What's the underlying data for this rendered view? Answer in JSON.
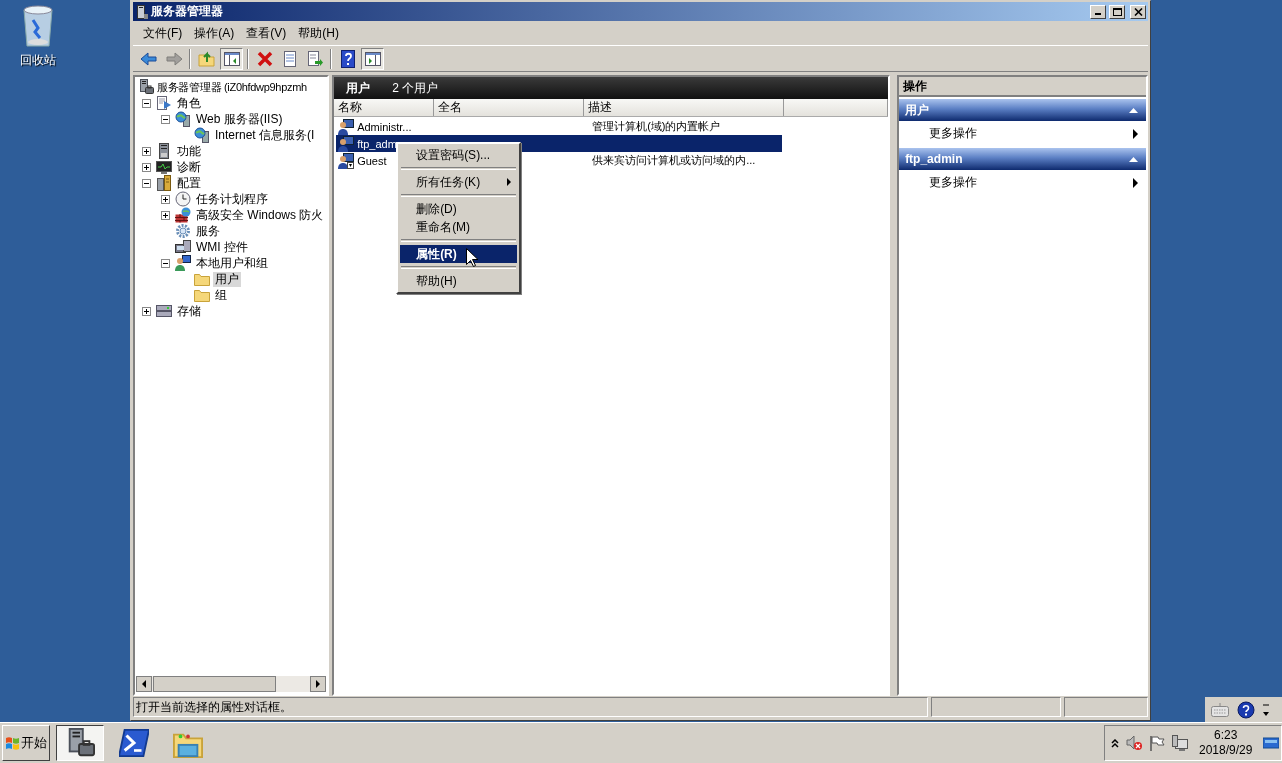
{
  "desktop_icons": [
    {
      "label": "回收站"
    }
  ],
  "window": {
    "title": "服务器管理器"
  },
  "menu": [
    {
      "label": "文件(F)"
    },
    {
      "label": "操作(A)"
    },
    {
      "label": "查看(V)"
    },
    {
      "label": "帮助(H)"
    }
  ],
  "toolbar": [
    {
      "kind": "back",
      "disabled": false,
      "pressed": false
    },
    {
      "kind": "forward",
      "disabled": true,
      "pressed": false
    },
    {
      "kind": "separator"
    },
    {
      "kind": "up",
      "disabled": false,
      "pressed": false
    },
    {
      "kind": "tree",
      "disabled": false,
      "pressed": true
    },
    {
      "kind": "separator"
    },
    {
      "kind": "delete",
      "disabled": false,
      "pressed": false
    },
    {
      "kind": "properties",
      "disabled": false,
      "pressed": false
    },
    {
      "kind": "export",
      "disabled": false,
      "pressed": false
    },
    {
      "kind": "separator"
    },
    {
      "kind": "help",
      "disabled": false,
      "pressed": false
    },
    {
      "kind": "actionpane",
      "disabled": false,
      "pressed": true
    }
  ],
  "tree": [
    {
      "label": "服务器管理器 (iZ0hfdwp9hpzmh",
      "kind": "server",
      "selected": false,
      "children": [
        {
          "label": "角色",
          "kind": "roles",
          "selected": false,
          "expanded": true,
          "children": [
            {
              "label": "Web 服务器(IIS)",
              "kind": "web",
              "selected": false,
              "expanded": true,
              "children": [
                {
                  "label": "Internet 信息服务(I",
                  "kind": "web",
                  "selected": false
                }
              ]
            }
          ]
        },
        {
          "label": "功能",
          "kind": "features",
          "selected": false,
          "expanded": false
        },
        {
          "label": "诊断",
          "kind": "diagnostics",
          "selected": false,
          "expanded": false
        },
        {
          "label": "配置",
          "kind": "config",
          "selected": false,
          "expanded": true,
          "children": [
            {
              "label": "任务计划程序",
              "kind": "scheduler",
              "selected": false,
              "expanded": false
            },
            {
              "label": "高级安全 Windows 防火",
              "kind": "firewall",
              "selected": false,
              "expanded": false
            },
            {
              "label": "服务",
              "kind": "services",
              "selected": false
            },
            {
              "label": "WMI 控件",
              "kind": "wmi",
              "selected": false
            },
            {
              "label": "本地用户和组",
              "kind": "users",
              "selected": false,
              "expanded": true,
              "children": [
                {
                  "label": "用户",
                  "kind": "folder",
                  "selected": true
                },
                {
                  "label": "组",
                  "kind": "folder",
                  "selected": false
                }
              ]
            }
          ]
        },
        {
          "label": "存储",
          "kind": "storage",
          "selected": false,
          "expanded": false
        }
      ]
    }
  ],
  "list": {
    "title": "用户",
    "count": "2 个用户",
    "columns": [
      "名称",
      "全名",
      "描述"
    ],
    "rows": [
      {
        "name": "Administr...",
        "description": "管理计算机(域)的内置帐户",
        "kind": "user",
        "selected": false
      },
      {
        "name": "ftp_adm",
        "kind": "user",
        "selected": true
      },
      {
        "name": "Guest",
        "description": "供来宾访问计算机或访问域的内...",
        "kind": "guest",
        "selected": false
      }
    ]
  },
  "context_menu": {
    "items": [
      {
        "kind": "item",
        "label": "设置密码(S)...",
        "selected": false,
        "default": false
      },
      {
        "kind": "separator"
      },
      {
        "kind": "submenu",
        "label": "所有任务(K)",
        "selected": false,
        "default": false
      },
      {
        "kind": "separator"
      },
      {
        "kind": "item",
        "label": "删除(D)",
        "selected": false,
        "default": false
      },
      {
        "kind": "item",
        "label": "重命名(M)",
        "selected": false,
        "default": false
      },
      {
        "kind": "separator"
      },
      {
        "kind": "item",
        "label": "属性(R)",
        "selected": true,
        "default": true
      },
      {
        "kind": "separator"
      },
      {
        "kind": "item",
        "label": "帮助(H)",
        "selected": false,
        "default": false
      }
    ]
  },
  "actions": {
    "title": "操作",
    "sections": [
      {
        "title": "用户",
        "expanded": true,
        "items": [
          {
            "label": "更多操作"
          }
        ]
      },
      {
        "title": "ftp_admin",
        "expanded": true,
        "items": [
          {
            "label": "更多操作"
          }
        ]
      }
    ]
  },
  "status_bar": {
    "text": "打开当前选择的属性对话框。"
  },
  "taskbar": {
    "start": "开始",
    "tasks": [
      {
        "kind": "server",
        "selected": true
      },
      {
        "kind": "powershell",
        "selected": false
      },
      {
        "kind": "explorer",
        "selected": false
      }
    ],
    "clock": {
      "time": "6:23",
      "date": "2018/9/29"
    }
  }
}
